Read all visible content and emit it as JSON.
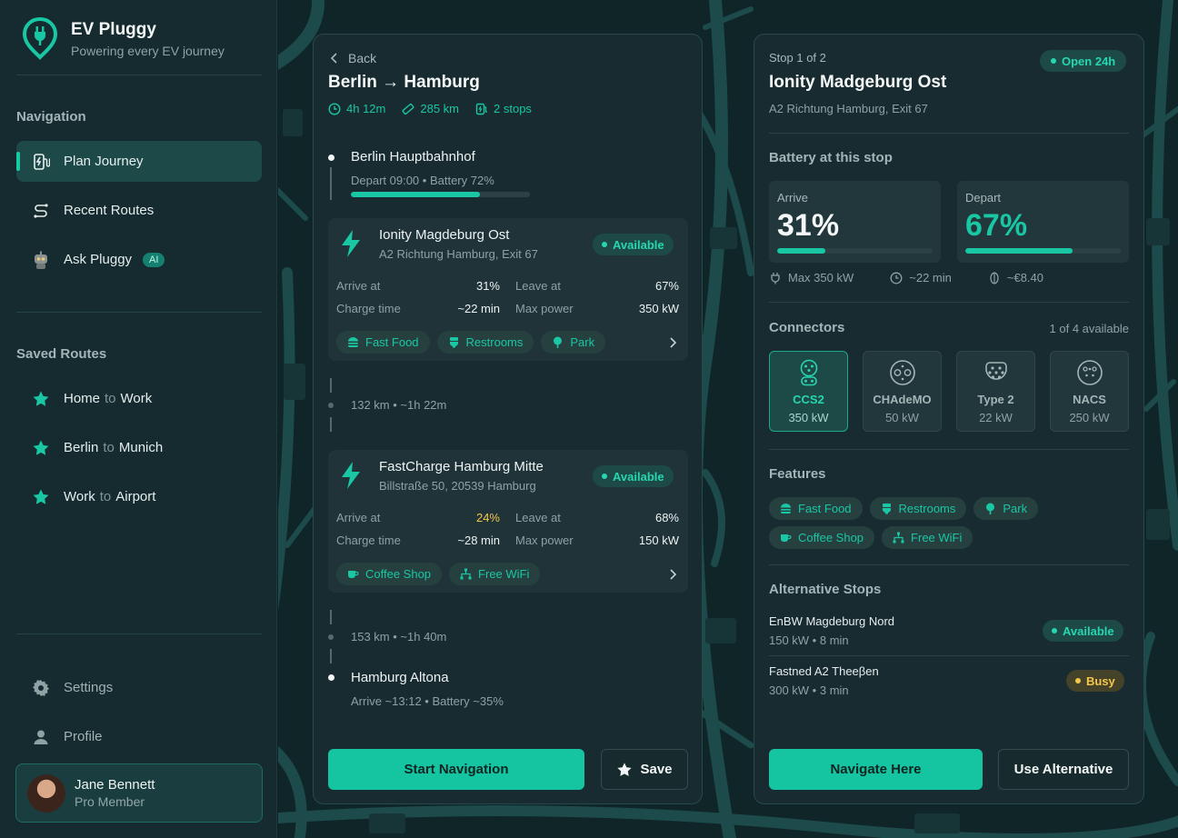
{
  "brand": {
    "title": "EV Pluggy",
    "tagline": "Powering every EV journey"
  },
  "sidebar": {
    "nav_heading": "Navigation",
    "nav_items": [
      {
        "label": "Plan Journey",
        "icon": "ev-charger-icon"
      },
      {
        "label": "Recent Routes",
        "icon": "route-icon"
      },
      {
        "label": "Ask Pluggy",
        "icon": "robot-icon",
        "badge": "AI"
      }
    ],
    "saved_heading": "Saved Routes",
    "saved_routes": [
      {
        "from": "Home",
        "sep": "to",
        "to": "Work"
      },
      {
        "from": "Berlin",
        "sep": "to",
        "to": "Munich"
      },
      {
        "from": "Work",
        "sep": "to",
        "to": "Airport"
      }
    ],
    "settings_label": "Settings",
    "profile_label": "Profile",
    "user": {
      "name": "Jane Bennett",
      "role": "Pro Member"
    }
  },
  "route": {
    "back_label": "Back",
    "from": "Berlin",
    "arrow": "→",
    "to": "Hamburg",
    "duration": "4h 12m",
    "distance": "285 km",
    "stops": "2 stops",
    "origin": {
      "name": "Berlin Hauptbahnhof",
      "depart": "Depart 09:00",
      "battery": "Battery 72%",
      "battery_level": 0.72
    },
    "segment1": "132 km • ~1h 22m",
    "stop1": {
      "name": "Ionity Magdeburg Ost",
      "address": "A2 Richtung Hamburg, Exit 67",
      "status": "Available",
      "arrive_label": "Arrive at",
      "arrive": "31%",
      "leave_label": "Leave at",
      "leave": "67%",
      "charge_label": "Charge time",
      "charge": "~22 min",
      "power_label": "Max power",
      "power": "350 kW",
      "amenities": [
        "Fast Food",
        "Restrooms",
        "Park"
      ]
    },
    "stop2": {
      "name": "FastCharge Hamburg Mitte",
      "address": "Billstraße 50, 20539 Hamburg",
      "status": "Available",
      "arrive_label": "Arrive at",
      "arrive": "24%",
      "leave_label": "Leave at",
      "leave": "68%",
      "charge_label": "Charge time",
      "charge": "~28 min",
      "power_label": "Max power",
      "power": "150 kW",
      "amenities": [
        "Coffee Shop",
        "Free WiFi"
      ]
    },
    "segment2": "153 km • ~1h 40m",
    "destination": {
      "name": "Hamburg Altona",
      "arrive": "Arrive ~13:12",
      "battery": "Battery ~35%"
    },
    "start_label": "Start Navigation",
    "save_label": "Save"
  },
  "stop_detail": {
    "stop_of": "Stop 1 of 2",
    "open": "Open 24h",
    "name": "Ionity Madgeburg Ost",
    "address": "A2 Richtung Hamburg, Exit 67",
    "battery_heading": "Battery at this stop",
    "arrive_label": "Arrive",
    "arrive": "31%",
    "arrive_level": 0.31,
    "depart_label": "Depart",
    "depart": "67%",
    "depart_level": 0.69,
    "max_power": "Max 350 kW",
    "time": "~22 min",
    "cost": "~€8.40",
    "connectors_heading": "Connectors",
    "connectors_count": "1 of 4 available",
    "connectors": [
      {
        "name": "CCS2",
        "power": "350 kW"
      },
      {
        "name": "CHAdeMO",
        "power": "50 kW"
      },
      {
        "name": "Type 2",
        "power": "22 kW"
      },
      {
        "name": "NACS",
        "power": "250 kW"
      }
    ],
    "features_heading": "Features",
    "features": [
      "Fast Food",
      "Restrooms",
      "Park",
      "Coffee Shop",
      "Free WiFi"
    ],
    "alt_heading": "Alternative Stops",
    "alternatives": [
      {
        "name": "EnBW Magdeburg Nord",
        "info": "150 kW • 8 min",
        "status": "Available"
      },
      {
        "name": "Fastned A2 Theeβen",
        "info": "300 kW • 3 min",
        "status": "Busy"
      }
    ],
    "navigate_label": "Navigate Here",
    "alt_label": "Use Alternative"
  },
  "colors": {
    "accent": "#19c7a4",
    "warning": "#f4c64a",
    "background": "#0f2326"
  }
}
